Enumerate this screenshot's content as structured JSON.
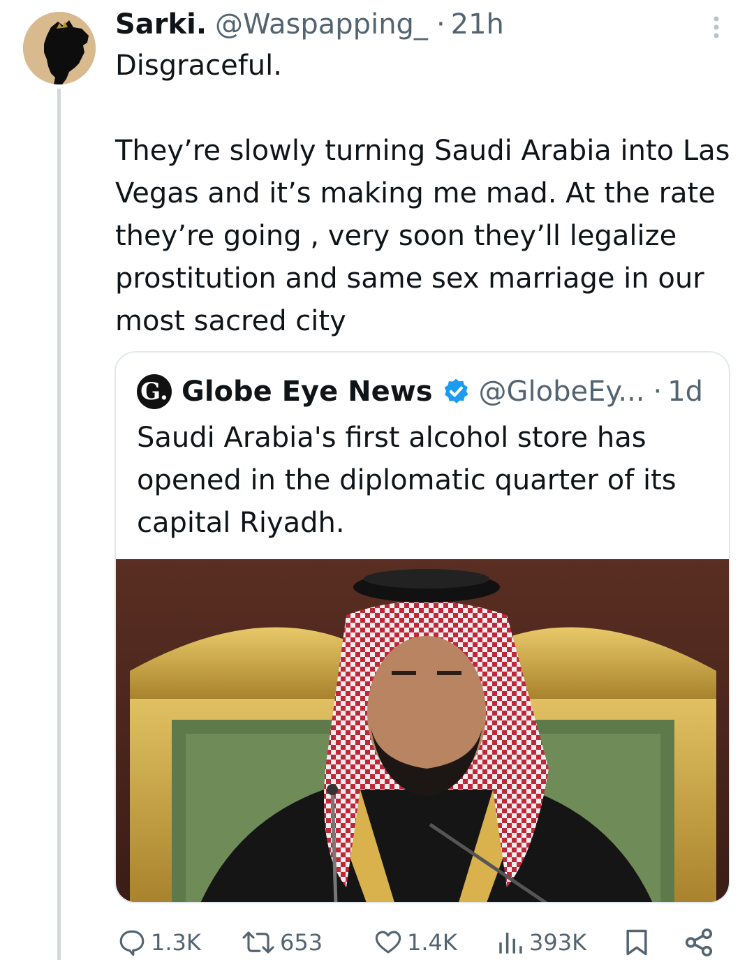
{
  "tweet": {
    "author_name": "Sarki.",
    "author_handle": "@Waspapping_",
    "separator": "·",
    "time": "21h",
    "text": "Disgraceful.\n\nThey’re slowly turning Saudi Arabia into Las Vegas and it’s making me mad. At the rate they’re going , very soon they’ll legalize prostitution and same sex marriage in our most sacred city"
  },
  "quote": {
    "logo_letter": "G.",
    "author_name": "Globe Eye News",
    "author_handle": "@GlobeEy...",
    "separator": "·",
    "time": "1d",
    "text": "Saudi Arabia's first alcohol store has opened in the diplomatic quarter of its capital Riyadh."
  },
  "actions": {
    "replies": "1.3K",
    "reposts": "653",
    "likes": "1.4K",
    "views": "393K"
  },
  "colors": {
    "text": "#0f1419",
    "muted": "#536471",
    "verified": "#1d9bf0",
    "border": "#e1e8ed"
  },
  "icons": [
    "more-icon",
    "verified-icon",
    "reply-icon",
    "repost-icon",
    "like-icon",
    "views-icon",
    "bookmark-icon",
    "share-icon"
  ]
}
